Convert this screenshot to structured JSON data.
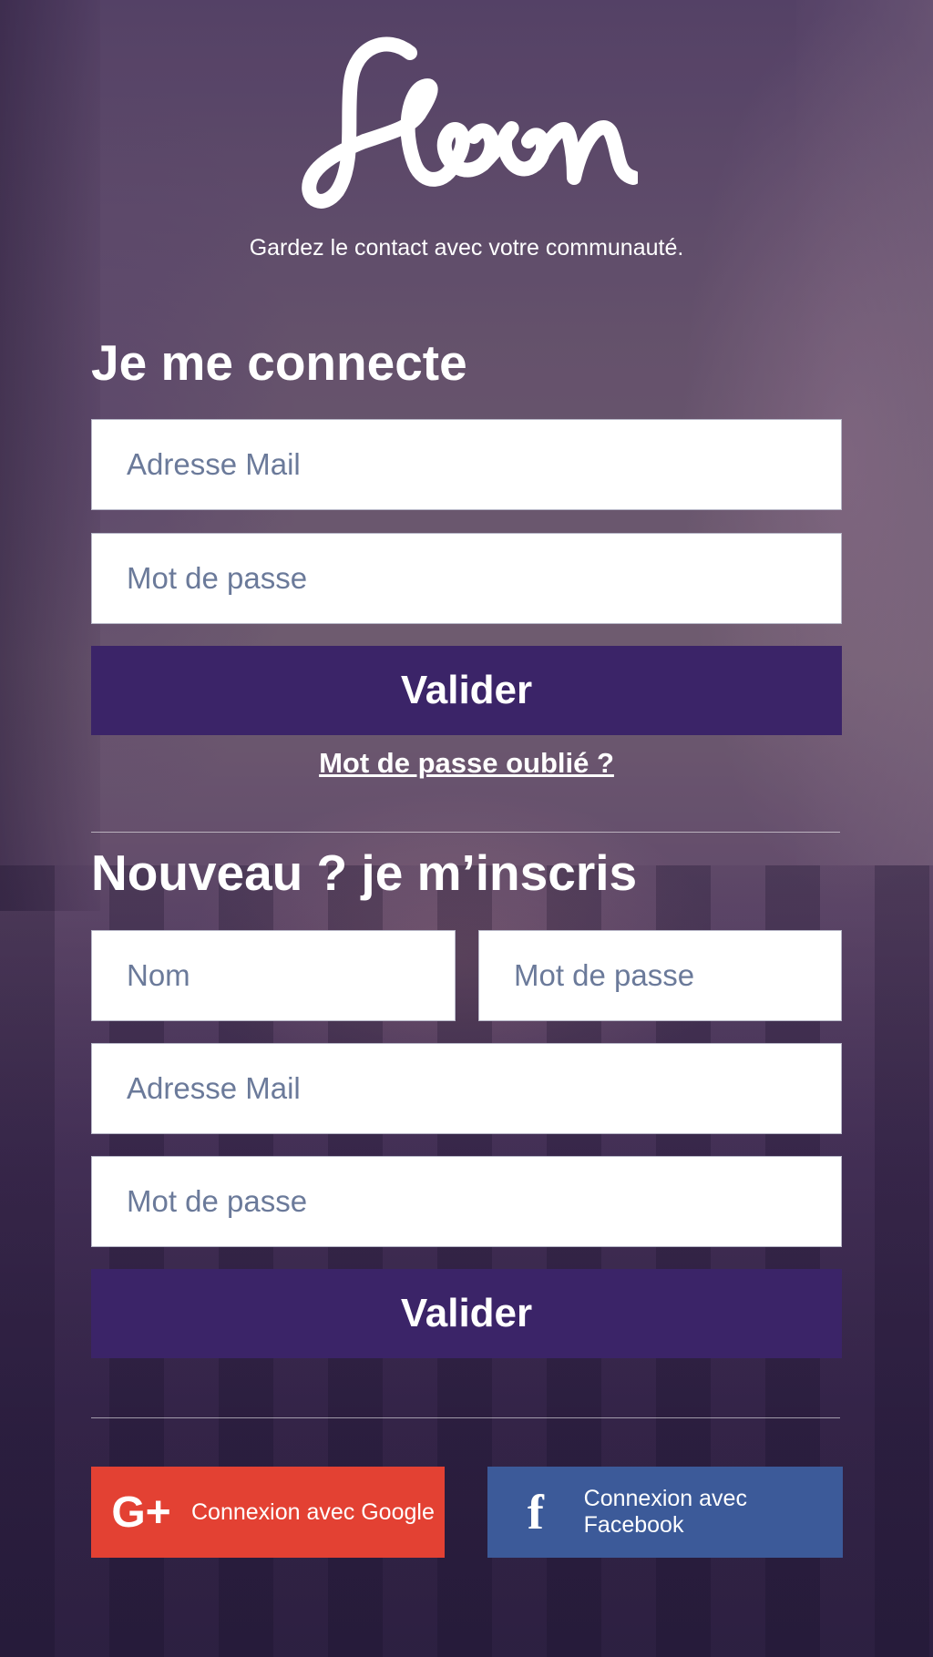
{
  "brand": {
    "tagline": "Gardez le contact avec votre communauté."
  },
  "login": {
    "heading": "Je me connecte",
    "email_placeholder": "Adresse Mail",
    "password_placeholder": "Mot de passe",
    "submit_label": "Valider",
    "forgot_label": "Mot de passe oublié ?"
  },
  "signup": {
    "heading": "Nouveau ? je m’inscris",
    "name_placeholder": "Nom",
    "password_placeholder_short": "Mot de passe",
    "email_placeholder": "Adresse Mail",
    "password_placeholder": "Mot de passe",
    "submit_label": "Valider"
  },
  "social": {
    "google": {
      "icon": "G+",
      "label": "Connexion avec Google",
      "color": "#e34133"
    },
    "facebook": {
      "icon": "f",
      "label": "Connexion avec Facebook",
      "color": "#3c5a99"
    }
  },
  "colors": {
    "primary_button": "#3b2468",
    "placeholder_text": "#6b7a9a"
  }
}
